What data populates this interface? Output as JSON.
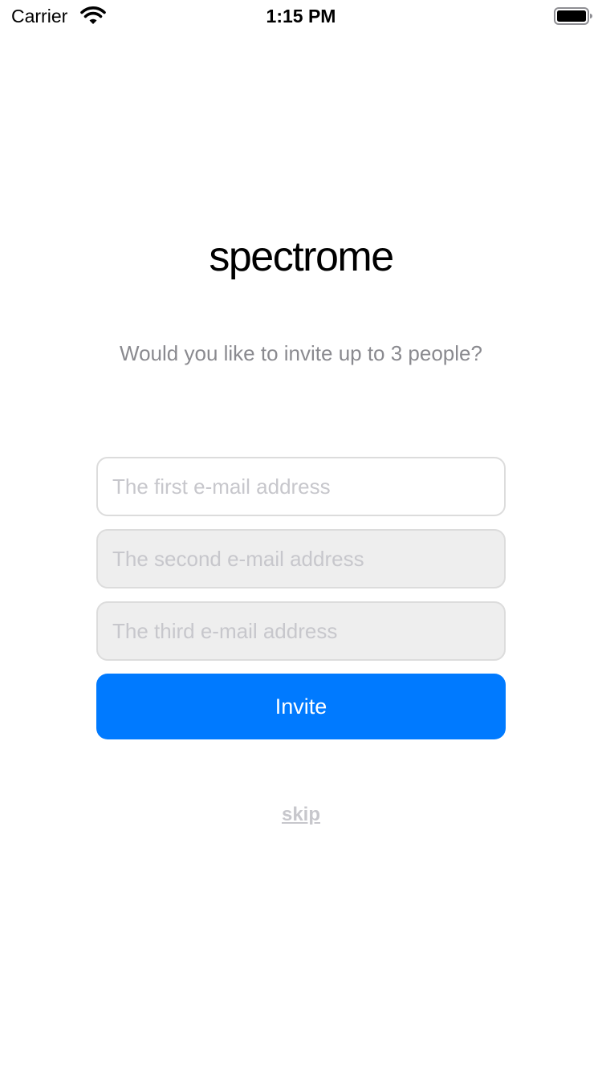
{
  "status_bar": {
    "carrier": "Carrier",
    "time": "1:15 PM"
  },
  "app": {
    "logo": "spectrome",
    "prompt": "Would you like to invite up to 3 people?"
  },
  "form": {
    "fields": [
      {
        "placeholder": "The first e-mail address",
        "value": ""
      },
      {
        "placeholder": "The second e-mail address",
        "value": ""
      },
      {
        "placeholder": "The third e-mail address",
        "value": ""
      }
    ],
    "invite_label": "Invite",
    "skip_label": "skip"
  },
  "colors": {
    "accent": "#007aff",
    "disabled_field": "#eeeeee",
    "placeholder": "#c7c7cc",
    "subtitle": "#8a8a8f"
  }
}
